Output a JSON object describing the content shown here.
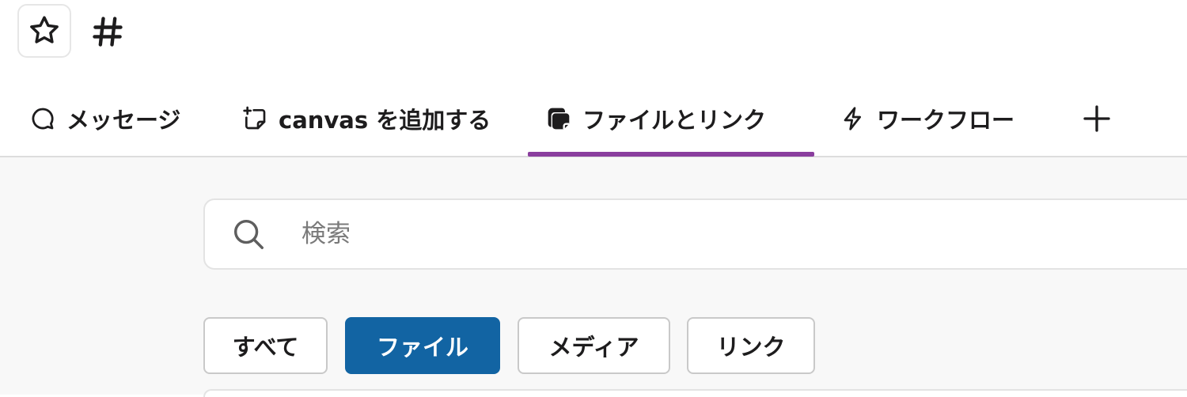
{
  "header": {
    "star_icon": "star-icon",
    "channel_icon": "hash-icon"
  },
  "tabs": [
    {
      "label": "メッセージ",
      "icon": "message-bubble-icon",
      "active": false
    },
    {
      "label": "canvas を追加する",
      "icon": "canvas-add-icon",
      "active": false
    },
    {
      "label": "ファイルとリンク",
      "icon": "files-icon",
      "active": true
    },
    {
      "label": "ワークフロー",
      "icon": "lightning-icon",
      "active": false
    }
  ],
  "add_tab_icon": "plus-icon",
  "search": {
    "placeholder": "検索",
    "value": ""
  },
  "filters": [
    {
      "label": "すべて",
      "active": false
    },
    {
      "label": "ファイル",
      "active": true
    },
    {
      "label": "メディア",
      "active": false
    },
    {
      "label": "リンク",
      "active": false
    }
  ],
  "colors": {
    "active_tab_underline": "#8a3e9e",
    "active_filter_bg": "#1264a3",
    "content_bg": "#f8f8f8"
  }
}
